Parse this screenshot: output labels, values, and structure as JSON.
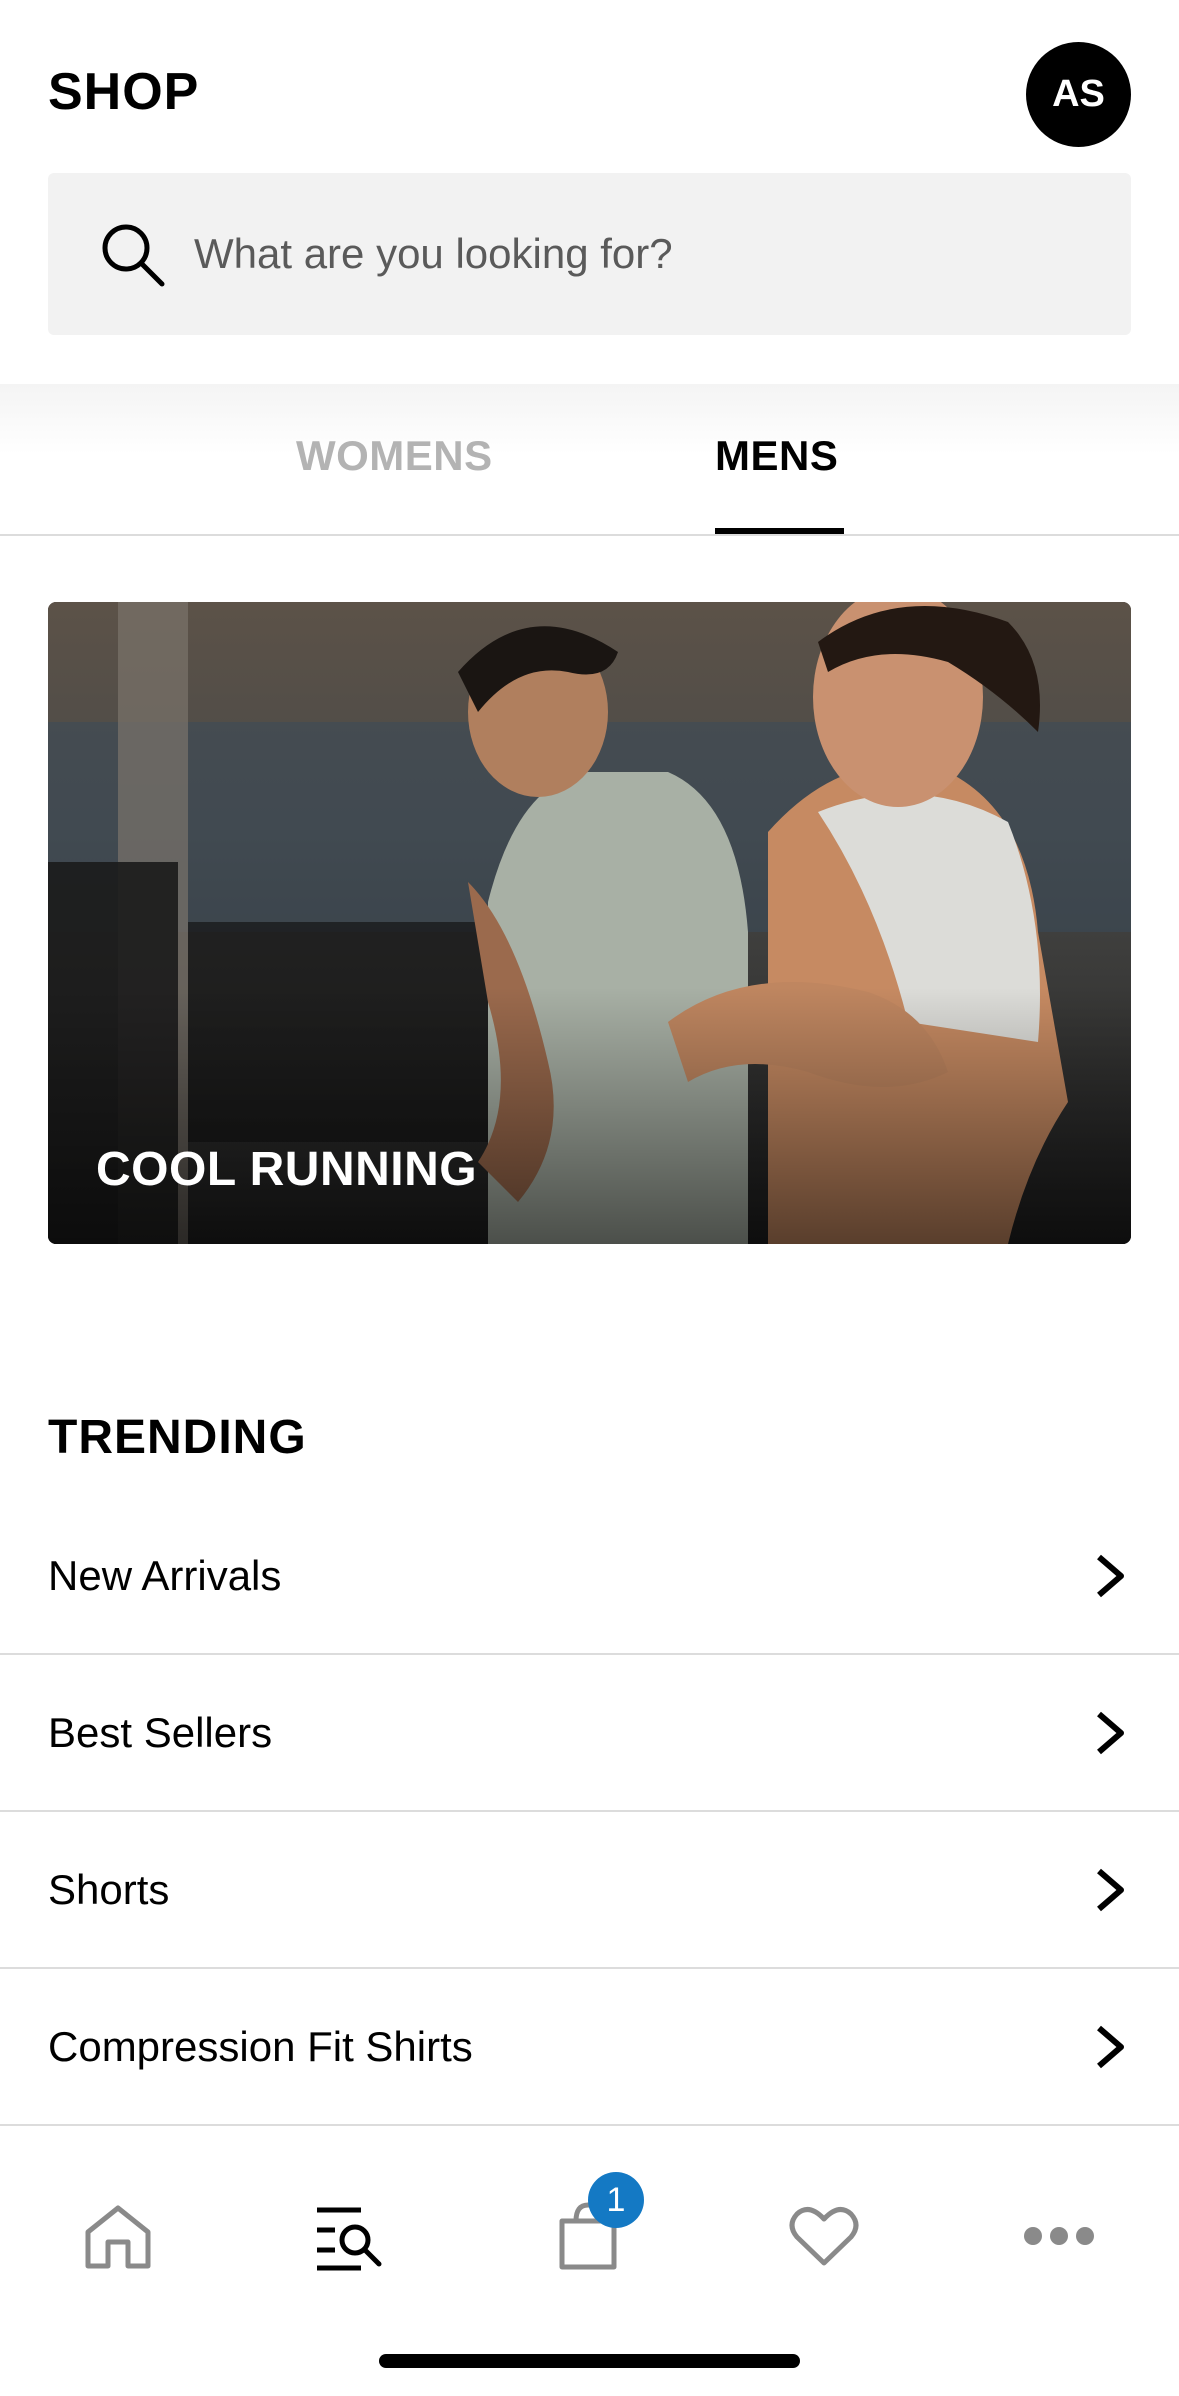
{
  "header": {
    "title": "SHOP",
    "avatar_initials": "AS"
  },
  "search": {
    "placeholder": "What are you looking for?",
    "icon": "search-icon"
  },
  "tabs": [
    {
      "label": "WOMENS",
      "active": false
    },
    {
      "label": "MENS",
      "active": true
    }
  ],
  "hero": {
    "title": "COOL RUNNING"
  },
  "trending": {
    "title": "TRENDING",
    "items": [
      {
        "label": "New Arrivals"
      },
      {
        "label": "Best Sellers"
      },
      {
        "label": "Shorts"
      },
      {
        "label": "Compression Fit Shirts"
      }
    ]
  },
  "bottom_nav": {
    "items": [
      {
        "icon": "home-icon"
      },
      {
        "icon": "search-menu-icon",
        "active": true
      },
      {
        "icon": "bag-icon",
        "badge": "1"
      },
      {
        "icon": "heart-icon"
      },
      {
        "icon": "more-icon"
      }
    ],
    "badge_color": "#1479c4"
  }
}
